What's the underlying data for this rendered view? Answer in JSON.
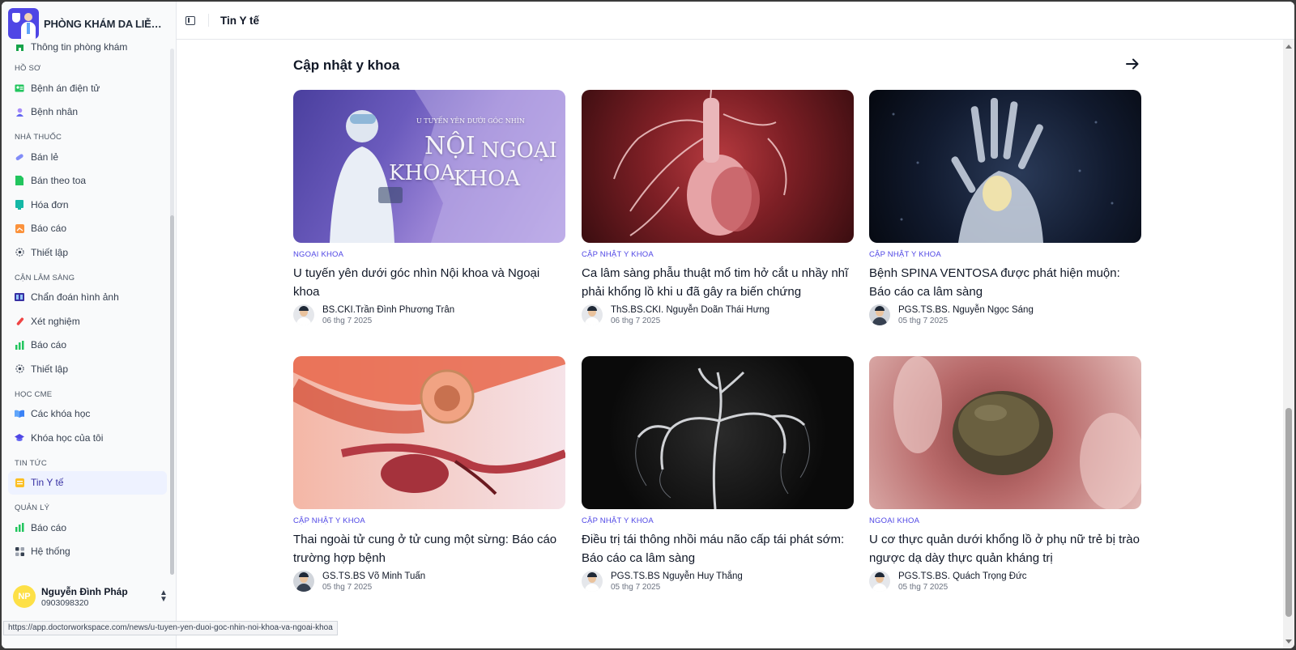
{
  "brand": {
    "name": "PHÒNG KHÁM DA LIỄU BÁ..."
  },
  "sidebar": {
    "partial_item": "Thông tin phòng khám",
    "groups": [
      {
        "label": "HỒ SƠ",
        "items": [
          {
            "label": "Bệnh án điện tử",
            "icon": "id-card-icon"
          },
          {
            "label": "Bệnh nhân",
            "icon": "user-icon"
          }
        ]
      },
      {
        "label": "NHÀ THUỐC",
        "items": [
          {
            "label": "Bán lẻ",
            "icon": "pill-icon"
          },
          {
            "label": "Bán theo toa",
            "icon": "prescription-icon"
          },
          {
            "label": "Hóa đơn",
            "icon": "invoice-icon"
          },
          {
            "label": "Báo cáo",
            "icon": "report-icon"
          },
          {
            "label": "Thiết lập",
            "icon": "gear-icon"
          }
        ]
      },
      {
        "label": "CẬN LÂM SÀNG",
        "items": [
          {
            "label": "Chẩn đoán hình ảnh",
            "icon": "imaging-icon"
          },
          {
            "label": "Xét nghiệm",
            "icon": "test-tube-icon"
          },
          {
            "label": "Báo cáo",
            "icon": "bar-chart-icon"
          },
          {
            "label": "Thiết lập",
            "icon": "gear-icon"
          }
        ]
      },
      {
        "label": "HỌC CME",
        "items": [
          {
            "label": "Các khóa học",
            "icon": "book-icon"
          },
          {
            "label": "Khóa học của tôi",
            "icon": "graduation-cap-icon"
          }
        ]
      },
      {
        "label": "TIN TỨC",
        "items": [
          {
            "label": "Tin Y tế",
            "icon": "news-icon",
            "active": true
          }
        ]
      },
      {
        "label": "QUẢN LÝ",
        "items": [
          {
            "label": "Báo cáo",
            "icon": "bar-chart-icon"
          },
          {
            "label": "Hệ thống",
            "icon": "grid-icon"
          }
        ]
      }
    ]
  },
  "user": {
    "initials": "NP",
    "name": "Nguyễn Đình Pháp",
    "phone": "0903098320"
  },
  "header": {
    "title": "Tin Y tế"
  },
  "main": {
    "section_title": "Cập nhật y khoa",
    "articles": [
      {
        "category": "NGOẠI KHOA",
        "title": "U tuyến yên dưới góc nhìn Nội khoa và Ngoại khoa",
        "author": "BS.CKI.Trần Đình Phương Trân",
        "date": "06 thg 7 2025",
        "thumb_small": "U TUYẾN YÊN DƯỚI GÓC NHÌN",
        "thumb_line1": "NỘI",
        "thumb_line2": "NGOẠI",
        "thumb_line3": "KHOA",
        "thumb_line4": "KHOA"
      },
      {
        "category": "CẬP NHẬT Y KHOA",
        "title": "Ca lâm sàng phẫu thuật mổ tim hở cắt u nhầy nhĩ phải khổng lồ khi u đã gây ra biến chứng",
        "author": "ThS.BS.CKI. Nguyễn Doãn Thái Hưng",
        "date": "06 thg 7 2025"
      },
      {
        "category": "CẬP NHẬT Y KHOA",
        "title": "Bệnh SPINA VENTOSA được phát hiện muộn: Báo cáo ca lâm sàng",
        "author": "PGS.TS.BS. Nguyễn Ngọc Sáng",
        "date": "05 thg 7 2025"
      },
      {
        "category": "CẬP NHẬT Y KHOA",
        "title": "Thai ngoài tử cung ở tử cung một sừng: Báo cáo trường hợp bệnh",
        "author": "GS.TS.BS Võ Minh Tuấn",
        "date": "05 thg 7 2025"
      },
      {
        "category": "CẬP NHẬT Y KHOA",
        "title": "Điều trị tái thông nhồi máu não cấp tái phát sớm: Báo cáo ca lâm sàng",
        "author": "PGS.TS.BS Nguyễn Huy Thắng",
        "date": "05 thg 7 2025"
      },
      {
        "category": "NGOẠI KHOA",
        "title": "U cơ thực quản dưới khổng lồ ở phụ nữ trẻ bị trào ngược dạ dày thực quản kháng trị",
        "author": "PGS.TS.BS. Quách Trọng Đức",
        "date": "05 thg 7 2025"
      }
    ]
  },
  "status_url": "https://app.doctorworkspace.com/news/u-tuyen-yen-duoi-goc-nhin-noi-khoa-va-ngoai-khoa",
  "colors": {
    "accent": "#4f46e5",
    "active_bg": "#eef2ff"
  }
}
